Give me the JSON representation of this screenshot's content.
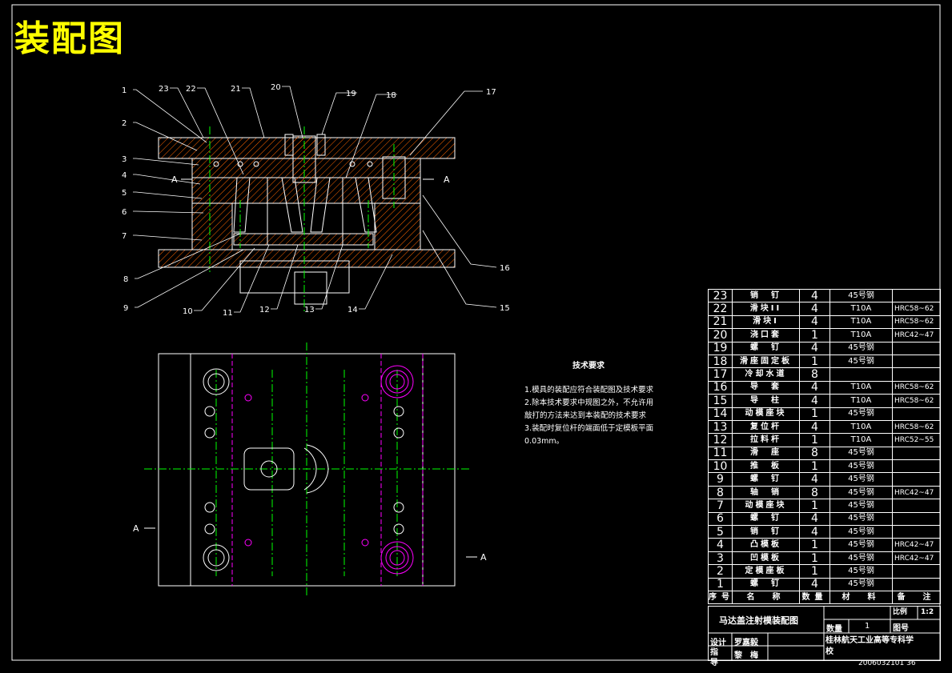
{
  "title": "装配图",
  "section_mark": "A",
  "callouts": [
    "1",
    "2",
    "3",
    "4",
    "5",
    "6",
    "7",
    "8",
    "9",
    "10",
    "11",
    "12",
    "13",
    "14",
    "15",
    "16",
    "17",
    "18",
    "19",
    "20",
    "21",
    "22",
    "23"
  ],
  "tech_requirements": {
    "heading": "技术要求",
    "lines": [
      "1.模具的装配应符合装配图及技术要求",
      "2.除本技术要求中规图之外，不允许用",
      "  敲打的方法来达到本装配的技术要求",
      "3.装配时复位杆的端面低于定模板平面",
      "  0.03mm。"
    ]
  },
  "bom": {
    "rows": [
      {
        "no": "23",
        "name": "销　钉",
        "qty": "4",
        "material": "45号钢",
        "remark": ""
      },
      {
        "no": "22",
        "name": "滑块II",
        "qty": "4",
        "material": "T10A",
        "remark": "HRC58~62"
      },
      {
        "no": "21",
        "name": "滑块I",
        "qty": "4",
        "material": "T10A",
        "remark": "HRC58~62"
      },
      {
        "no": "20",
        "name": "浇口套",
        "qty": "1",
        "material": "T10A",
        "remark": "HRC42~47"
      },
      {
        "no": "19",
        "name": "螺　钉",
        "qty": "4",
        "material": "45号钢",
        "remark": ""
      },
      {
        "no": "18",
        "name": "滑座固定板",
        "qty": "1",
        "material": "45号钢",
        "remark": ""
      },
      {
        "no": "17",
        "name": "冷却水道",
        "qty": "8",
        "material": "",
        "remark": ""
      },
      {
        "no": "16",
        "name": "导　套",
        "qty": "4",
        "material": "T10A",
        "remark": "HRC58~62"
      },
      {
        "no": "15",
        "name": "导　柱",
        "qty": "4",
        "material": "T10A",
        "remark": "HRC58~62"
      },
      {
        "no": "14",
        "name": "动模座块",
        "qty": "1",
        "material": "45号钢",
        "remark": ""
      },
      {
        "no": "13",
        "name": "复位杆",
        "qty": "4",
        "material": "T10A",
        "remark": "HRC58~62"
      },
      {
        "no": "12",
        "name": "拉料杆",
        "qty": "1",
        "material": "T10A",
        "remark": "HRC52~55"
      },
      {
        "no": "11",
        "name": "滑　座",
        "qty": "8",
        "material": "45号钢",
        "remark": ""
      },
      {
        "no": "10",
        "name": "推　板",
        "qty": "1",
        "material": "45号钢",
        "remark": ""
      },
      {
        "no": "9",
        "name": "螺　钉",
        "qty": "4",
        "material": "45号钢",
        "remark": ""
      },
      {
        "no": "8",
        "name": "轴　销",
        "qty": "8",
        "material": "45号钢",
        "remark": "HRC42~47"
      },
      {
        "no": "7",
        "name": "动模座块",
        "qty": "1",
        "material": "45号钢",
        "remark": ""
      },
      {
        "no": "6",
        "name": "螺　钉",
        "qty": "4",
        "material": "45号钢",
        "remark": ""
      },
      {
        "no": "5",
        "name": "销　钉",
        "qty": "4",
        "material": "45号钢",
        "remark": ""
      },
      {
        "no": "4",
        "name": "凸模板",
        "qty": "1",
        "material": "45号钢",
        "remark": "HRC42~47"
      },
      {
        "no": "3",
        "name": "凹模板",
        "qty": "1",
        "material": "45号钢",
        "remark": "HRC42~47"
      },
      {
        "no": "2",
        "name": "定模座板",
        "qty": "1",
        "material": "45号钢",
        "remark": ""
      },
      {
        "no": "1",
        "name": "螺　钉",
        "qty": "4",
        "material": "45号钢",
        "remark": ""
      }
    ],
    "header": {
      "no": "序号",
      "name": "名　称",
      "qty": "数量",
      "material": "材　料",
      "remark": "备　注"
    }
  },
  "title_block": {
    "drawing_name": "马达盖注射模装配图",
    "scale_label": "比例",
    "scale_value": "1:2",
    "qty_label": "数量",
    "qty_value": "1",
    "drawing_no_label": "图号",
    "designer_label": "设计",
    "designer_name": "罗嘉毅",
    "instructor_label": "指导",
    "instructor_name": "黎　梅",
    "school": "桂林航天工业高等专科学校",
    "student_id": "2006032101 36"
  },
  "colors": {
    "background": "#000000",
    "title": "#ffff00",
    "center_line": "#00ff00",
    "hidden": "#ff00ff",
    "hatch": "#ff6600",
    "outline": "#ffffff"
  }
}
